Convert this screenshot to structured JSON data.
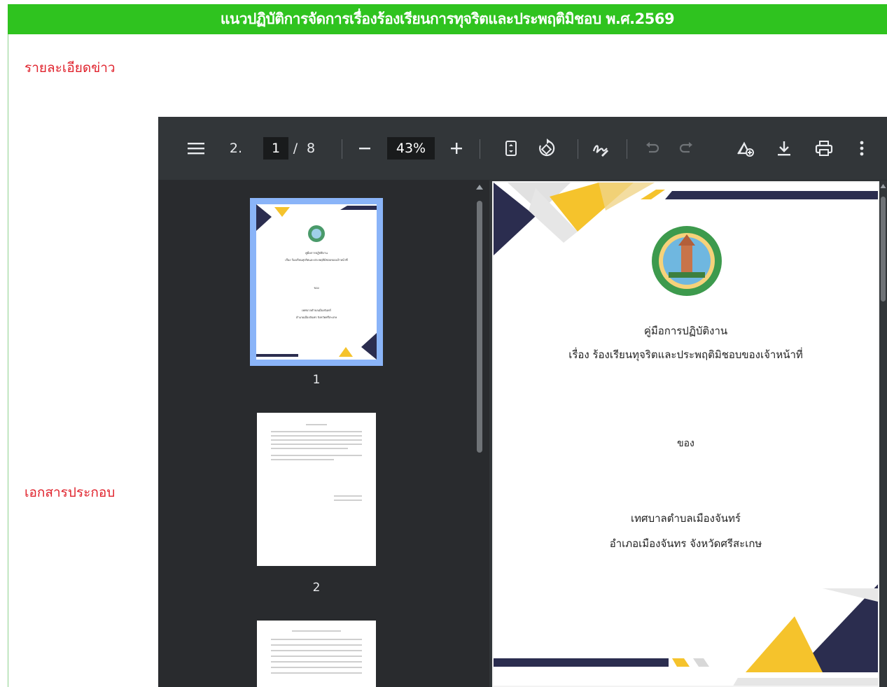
{
  "banner": {
    "title": "แนวปฏิบัติการจัดการเรื่องร้องเรียนการทุจริตและประพฤติมิชอบ พ.ศ.2569"
  },
  "labels": {
    "news_detail": "รายละเอียดข่าว",
    "attachments": "เอกสารประกอบ"
  },
  "pdf_viewer": {
    "doc_title": "2.",
    "current_page": "1",
    "page_sep": "/",
    "total_pages": "8",
    "zoom": "43%",
    "thumbnails": [
      {
        "number": "1"
      },
      {
        "number": "2"
      }
    ],
    "page": {
      "heading": "คู่มือการปฏิบัติงาน",
      "subject": "เรื่อง ร้องเรียนทุจริตและประพฤติมิชอบของเจ้าหน้าที่",
      "of": "ของ",
      "org": "เทศบาลตำบลเมืองจันทร์",
      "district": "อำเภอเมืองจันทร จังหวัดศรีสะเกษ"
    },
    "thumb1": {
      "heading": "คู่มือการปฏิบัติงาน",
      "subject": "เรื่อง ร้องเรียนทุจริตและประพฤติมิชอบของเจ้าหน้าที่",
      "of": "ของ",
      "org": "เทศบาลตำบลเมืองจันทร์",
      "district": "อำเภอเมืองจันทร จังหวัดศรีสะเกษ"
    }
  },
  "colors": {
    "banner": "#2fc31f",
    "label": "#e0222c",
    "navy": "#2b2d4f",
    "yellow": "#f5c32c"
  }
}
